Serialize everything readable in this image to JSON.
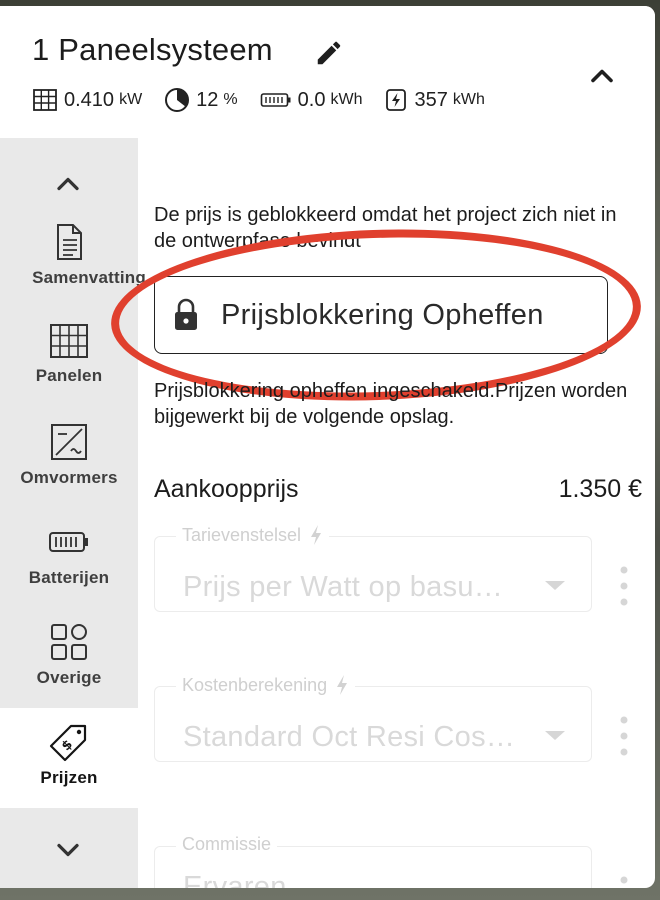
{
  "header": {
    "title": "1 Paneelsysteem",
    "stats": [
      {
        "icon": "solar-panel-icon",
        "value": "0.410",
        "unit": "kW"
      },
      {
        "icon": "pie-chart-icon",
        "value": "12",
        "unit": "%"
      },
      {
        "icon": "battery-icon",
        "value": "0.0",
        "unit": "kWh"
      },
      {
        "icon": "energy-icon",
        "value": "357",
        "unit": "kWh"
      }
    ]
  },
  "sidebar": {
    "items": [
      {
        "label": "Samenvatting",
        "icon": "document-icon"
      },
      {
        "label": "Panelen",
        "icon": "panel-grid-icon"
      },
      {
        "label": "Omvormers",
        "icon": "inverter-icon"
      },
      {
        "label": "Batterijen",
        "icon": "battery-icon"
      },
      {
        "label": "Overige",
        "icon": "apps-icon"
      },
      {
        "label": "Prijzen",
        "icon": "price-tag-icon",
        "active": true
      }
    ]
  },
  "content": {
    "notice": "De prijs is geblokkeerd omdat het project zich niet in de ontwerpfase bevindt",
    "unlock_button": "Prijsblokkering Opheffen",
    "info": "Prijsblokkering opheffen ingeschakeld.Prijzen worden bijgewerkt bij de volgende opslag.",
    "price_label": "Aankoopprijs",
    "price_value": "1.350 €",
    "fields": [
      {
        "label": "Tarievenstelsel",
        "value": "Prijs per Watt op basu…"
      },
      {
        "label": "Kostenberekening",
        "value": "Standard Oct Resi Cos…"
      },
      {
        "label": "Commissie",
        "value": "Ervaren"
      }
    ]
  },
  "colors": {
    "highlight": "#e0402e",
    "sidebar_bg": "#e9e9e9",
    "disabled_text": "#d9d9d9"
  }
}
